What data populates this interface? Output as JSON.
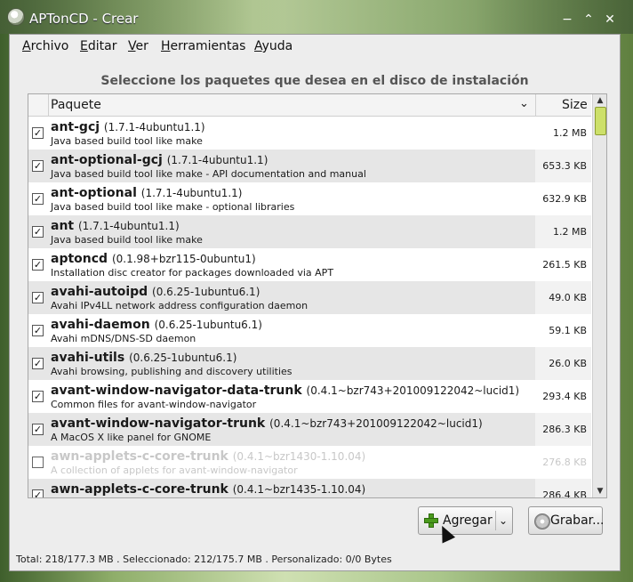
{
  "window": {
    "title": "APTonCD - Crear",
    "controls": [
      "−",
      "⌃",
      "✕"
    ]
  },
  "menu": [
    {
      "label": "Archivo",
      "mnemonic": "A",
      "rest": "rchivo"
    },
    {
      "label": "Editar",
      "mnemonic": "E",
      "rest": "ditar"
    },
    {
      "label": "Ver",
      "mnemonic": "V",
      "rest": "er"
    },
    {
      "label": "Herramientas",
      "mnemonic": "H",
      "rest": "erramientas"
    },
    {
      "label": "Ayuda",
      "mnemonic": "A",
      "rest": "yuda"
    }
  ],
  "heading": "Seleccione los paquetes que desea en el disco de instalación",
  "list": {
    "columns": {
      "package": "Paquete",
      "size": "Size"
    },
    "rows": [
      {
        "name": "ant-gcj",
        "version": "(1.7.1-4ubuntu1.1)",
        "description": "Java based build tool like make",
        "size": "1.2 MB",
        "checked": true
      },
      {
        "name": "ant-optional-gcj",
        "version": "(1.7.1-4ubuntu1.1)",
        "description": "Java based build tool like make - API documentation and manual",
        "size": "653.3 KB",
        "checked": true
      },
      {
        "name": "ant-optional",
        "version": "(1.7.1-4ubuntu1.1)",
        "description": "Java based build tool like make - optional libraries",
        "size": "632.9 KB",
        "checked": true
      },
      {
        "name": "ant",
        "version": "(1.7.1-4ubuntu1.1)",
        "description": "Java based build tool like make",
        "size": "1.2 MB",
        "checked": true
      },
      {
        "name": "aptoncd",
        "version": "(0.1.98+bzr115-0ubuntu1)",
        "description": "Installation disc creator for packages downloaded via APT",
        "size": "261.5 KB",
        "checked": true
      },
      {
        "name": "avahi-autoipd",
        "version": "(0.6.25-1ubuntu6.1)",
        "description": "Avahi IPv4LL network address configuration daemon",
        "size": "49.0 KB",
        "checked": true
      },
      {
        "name": "avahi-daemon",
        "version": "(0.6.25-1ubuntu6.1)",
        "description": "Avahi mDNS/DNS-SD daemon",
        "size": "59.1 KB",
        "checked": true
      },
      {
        "name": "avahi-utils",
        "version": "(0.6.25-1ubuntu6.1)",
        "description": "Avahi browsing, publishing and discovery utilities",
        "size": "26.0 KB",
        "checked": true
      },
      {
        "name": "avant-window-navigator-data-trunk",
        "version": "(0.4.1~bzr743+201009122042~lucid1)",
        "description": "Common files for avant-window-navigator",
        "size": "293.4 KB",
        "checked": true
      },
      {
        "name": "avant-window-navigator-trunk",
        "version": "(0.4.1~bzr743+201009122042~lucid1)",
        "description": "A MacOS X like panel for GNOME",
        "size": "286.3 KB",
        "checked": true
      },
      {
        "name": "awn-applets-c-core-trunk",
        "version": "(0.4.1~bzr1430-1.10.04)",
        "description": "A collection of applets for avant-window-navigator",
        "size": "276.8 KB",
        "checked": false
      },
      {
        "name": "awn-applets-c-core-trunk",
        "version": "(0.4.1~bzr1435-1.10.04)",
        "description": "",
        "size": "286.4 KB",
        "checked": true
      }
    ]
  },
  "buttons": {
    "add": "Agregar",
    "burn": "Grabar..."
  },
  "status": "Total: 218/177.3 MB . Seleccionado: 212/175.7 MB . Personalizado: 0/0 Bytes"
}
